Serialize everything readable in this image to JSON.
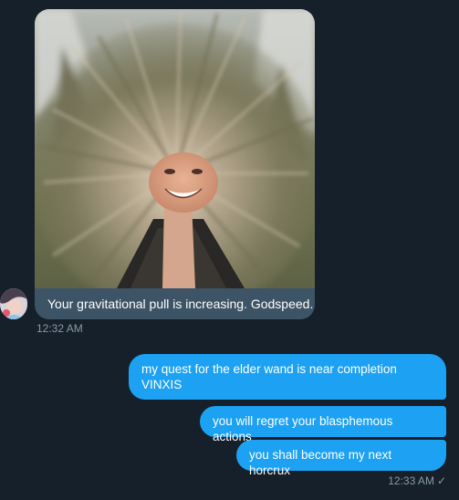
{
  "incoming": {
    "caption": "Your gravitational pull is increasing. Godspeed.",
    "timestamp": "12:32 AM"
  },
  "outgoing": {
    "messages": [
      "my quest for the elder wand is near completion VINXIS",
      "you will regret your blasphemous actions",
      "you shall become my next horcrux"
    ],
    "timestamp": "12:33 AM",
    "read_mark": "✓"
  },
  "colors": {
    "background": "#15202b",
    "outgoing_bubble": "#1da1f2",
    "incoming_caption_bg": "#3d5466",
    "muted_text": "#8899a6"
  }
}
